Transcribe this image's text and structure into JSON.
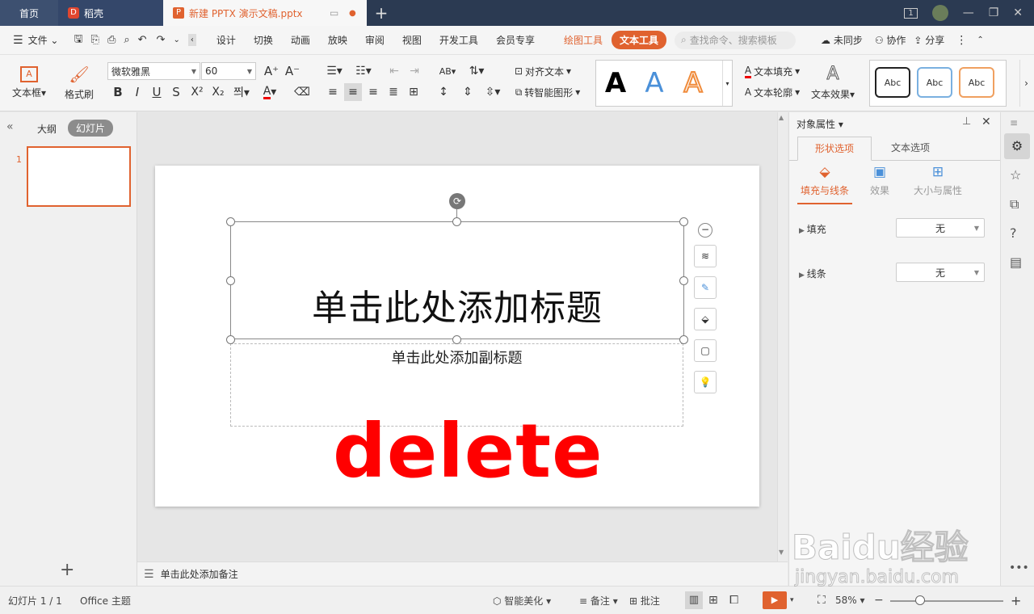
{
  "tabs": {
    "home": "首页",
    "daoke": "稻壳",
    "doc": "新建 PPTX 演示文稿.pptx",
    "page_indicator": "1"
  },
  "menu": {
    "file": "文件",
    "items": [
      "设计",
      "切换",
      "动画",
      "放映",
      "审阅",
      "视图",
      "开发工具",
      "会员专享"
    ],
    "draw_tool": "绘图工具",
    "text_tool": "文本工具",
    "search_placeholder": "查找命令、搜索模板",
    "unsync": "未同步",
    "collab": "协作",
    "share": "分享"
  },
  "ribbon": {
    "textbox": "文本框",
    "format_brush": "格式刷",
    "font_name": "微软雅黑",
    "font_size": "60",
    "align_text": "对齐文本",
    "smart_shape": "转智能图形",
    "text_fill": "文本填充",
    "text_outline": "文本轮廓",
    "text_effect": "文本效果",
    "styles": [
      "A",
      "A",
      "A"
    ],
    "shape_styles": [
      "Abc",
      "Abc",
      "Abc"
    ],
    "bold": "B",
    "italic": "I",
    "underline": "U",
    "strike": "S",
    "sup": "X²",
    "sub": "X₂",
    "font_color": "A"
  },
  "sidebar": {
    "outline": "大纲",
    "slides": "幻灯片",
    "slide_number": "1"
  },
  "slide": {
    "title": "单击此处添加标题",
    "subtitle": "单击此处添加副标题",
    "overlay": "delete"
  },
  "notes": {
    "placeholder": "单击此处添加备注"
  },
  "panel": {
    "title": "对象属性",
    "tab_shape": "形状选项",
    "tab_text": "文本选项",
    "sub_fill": "填充与线条",
    "sub_effect": "效果",
    "sub_size": "大小与属性",
    "fill_label": "填充",
    "fill_value": "无",
    "line_label": "线条",
    "line_value": "无"
  },
  "status": {
    "slide_count": "幻灯片 1 / 1",
    "theme": "Office 主题",
    "smart_beautify": "智能美化",
    "notes": "备注",
    "comments": "批注",
    "zoom": "58%"
  },
  "watermark": {
    "logo": "Baidu经验",
    "url": "jingyan.baidu.com"
  },
  "colors": {
    "accent": "#e0622f",
    "tabbar": "#2b3a52",
    "overlay_red": "#ff0000"
  }
}
